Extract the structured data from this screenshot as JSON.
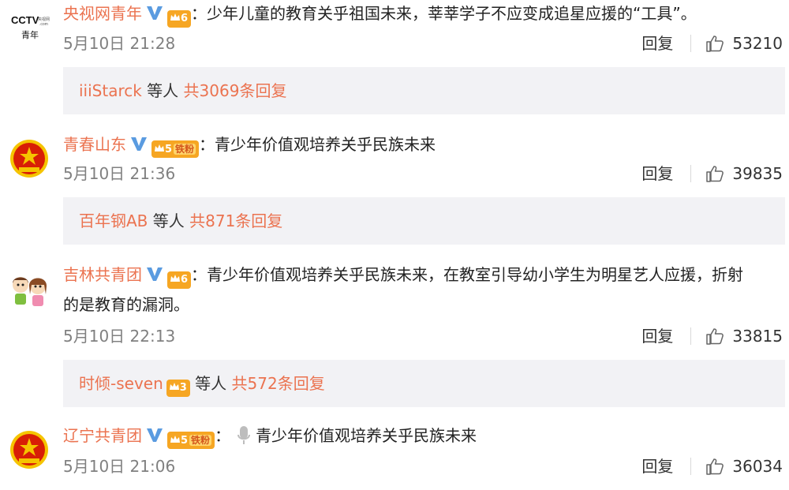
{
  "comments": [
    {
      "avatar": "cctv-youth-logo",
      "username": "央视网青年",
      "badge": "vip-v",
      "level": "6",
      "fan_label": "",
      "text": "：少年儿童的教育关乎祖国未来，莘莘学子不应变成追星应援的“工具”。",
      "time": "5月10日 21:28",
      "reply_label": "回复",
      "likes": "53210",
      "replies": {
        "name": "iiiStarck",
        "middle": " 等人 ",
        "count": "共3069条回复"
      }
    },
    {
      "avatar": "communist-youth-league-emblem",
      "username": "青春山东",
      "badge": "vip-v",
      "level": "5",
      "fan_label": "铁粉",
      "text": "：青少年价值观培养关乎民族未来",
      "time": "5月10日 21:36",
      "reply_label": "回复",
      "likes": "39835",
      "replies": {
        "name": "百年钢AB",
        "middle": " 等人 ",
        "count": "共871条回复"
      }
    },
    {
      "avatar": "cartoon-kids",
      "username": "吉林共青团",
      "badge": "vip-v",
      "level": "6",
      "fan_label": "",
      "text": "：青少年价值观培养关乎民族未来，在教室引导幼小学生为明星艺人应援，折射",
      "text2": "的是教育的漏洞。",
      "time": "5月10日 22:13",
      "reply_label": "回复",
      "likes": "33815",
      "replies": {
        "name": "时倾-seven",
        "level": "3",
        "middle": " 等人 ",
        "count": "共572条回复"
      }
    },
    {
      "avatar": "communist-youth-league-emblem",
      "username": "辽宁共青团",
      "badge": "vip-v",
      "level": "5",
      "fan_label": "铁粉",
      "text": "青少年价值观培养关乎民族未来",
      "time": "5月10日 21:06",
      "reply_label": "回复",
      "likes": "36034"
    }
  ],
  "colors": {
    "username": "#eb7350",
    "meta": "#808080",
    "reply_bg": "#f2f2f5",
    "v_badge": "#5a9be0"
  }
}
